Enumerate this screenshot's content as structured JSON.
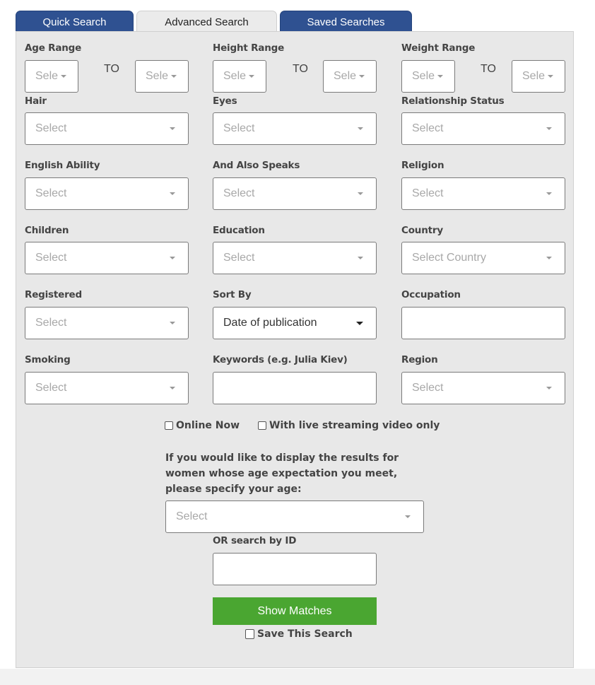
{
  "tabs": [
    {
      "label": "Quick Search",
      "active": false
    },
    {
      "label": "Advanced Search",
      "active": true
    },
    {
      "label": "Saved Searches",
      "active": false
    }
  ],
  "colors": {
    "tab_inactive": "#2f5191",
    "panel_bg": "#e8e8e8",
    "button_green": "#4aa631"
  },
  "ranges": {
    "to_label": "TO",
    "age": {
      "label": "Age Range",
      "from": "Sele",
      "to": "Sele"
    },
    "height": {
      "label": "Height Range",
      "from": "Sele",
      "to": "Sele"
    },
    "weight": {
      "label": "Weight Range",
      "from": "Sele",
      "to": "Sele"
    }
  },
  "fields": {
    "hair": {
      "label": "Hair",
      "value": "Select"
    },
    "eyes": {
      "label": "Eyes",
      "value": "Select"
    },
    "relationship_status": {
      "label": "Relationship Status",
      "value": "Select"
    },
    "english_ability": {
      "label": "English Ability",
      "value": "Select"
    },
    "also_speaks": {
      "label": "And Also Speaks",
      "value": "Select"
    },
    "religion": {
      "label": "Religion",
      "value": "Select"
    },
    "children": {
      "label": "Children",
      "value": "Select"
    },
    "education": {
      "label": "Education",
      "value": "Select"
    },
    "country": {
      "label": "Country",
      "value": "Select Country"
    },
    "registered": {
      "label": "Registered",
      "value": "Select"
    },
    "sort_by": {
      "label": "Sort By",
      "value": "Date of publication"
    },
    "occupation": {
      "label": "Occupation",
      "value": ""
    },
    "smoking": {
      "label": "Smoking",
      "value": "Select"
    },
    "keywords": {
      "label": "Keywords (e.g. Julia Kiev)",
      "value": ""
    },
    "region": {
      "label": "Region",
      "value": "Select"
    }
  },
  "checkboxes": {
    "online_now": {
      "label": "Online Now",
      "checked": false
    },
    "live_video": {
      "label": "With live streaming video only",
      "checked": false
    },
    "save_search": {
      "label": "Save This Search",
      "checked": false
    }
  },
  "age_expectation": {
    "note": "If you would like to display the results for women whose age expectation you meet, please specify your age:",
    "value": "Select"
  },
  "search_by_id": {
    "label": "OR search by ID",
    "value": ""
  },
  "submit": {
    "label": "Show Matches"
  }
}
